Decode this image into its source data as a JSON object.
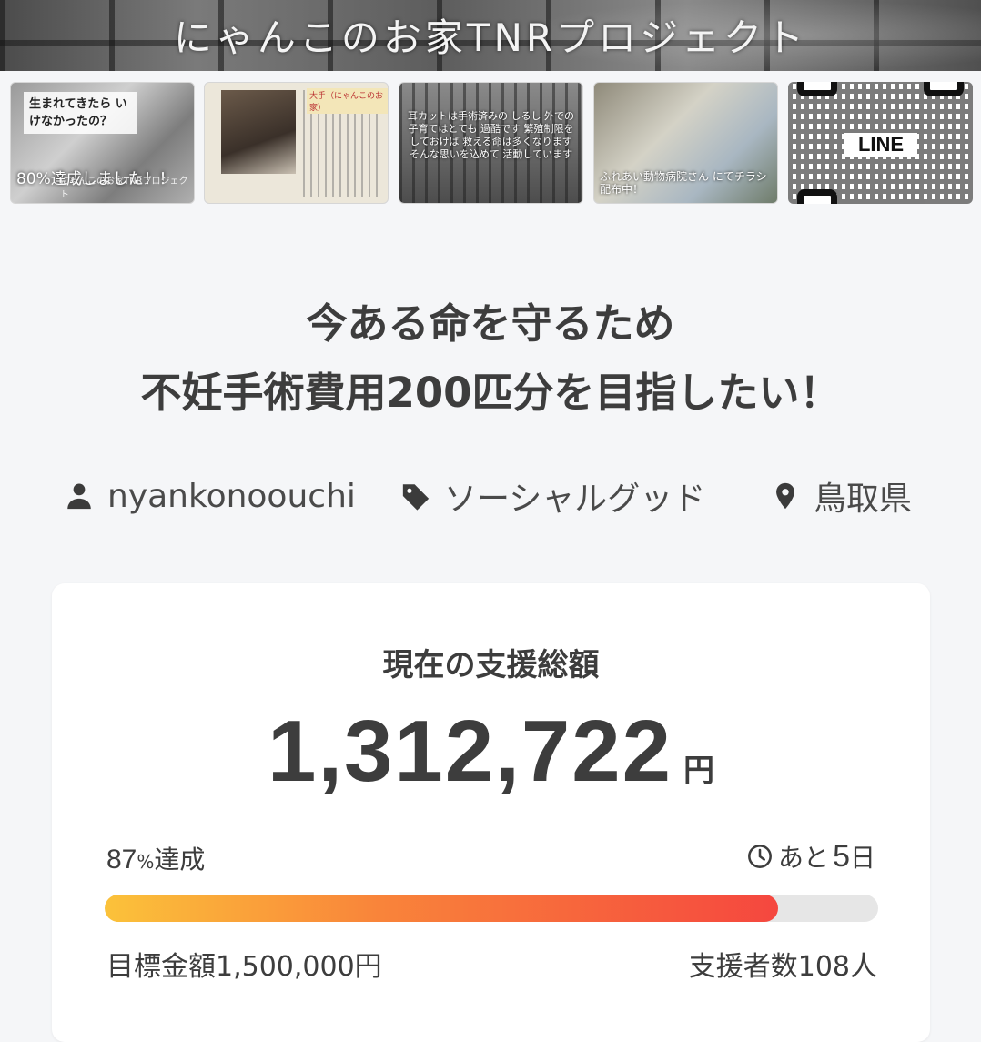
{
  "hero": {
    "title": "にゃんこのお家TNRプロジェクト"
  },
  "thumbnails": [
    {
      "caption_note": "生まれてきたら いけなかったの？",
      "caption_big": "80%達成しました！！",
      "caption_small": "にゃんこのお家TNRプロジェクト"
    },
    {
      "tag": "大手（にゃんこのお家）"
    },
    {
      "caption": "耳カットは手術済みの しるし 外での子育てはとても 過酷です 繁殖制限をしておけば 救える命は多くなります そんな思いを込めて 活動しています"
    },
    {
      "caption": "ふれあい動物病院さん にてチラシ配布中！"
    },
    {
      "label": "LINE"
    }
  ],
  "title": {
    "line1": "今ある命を守るため",
    "line2": "不妊手術費用200匹分を目指したい！"
  },
  "meta": {
    "user": "nyankonoouchi",
    "category": "ソーシャルグッド",
    "location": "鳥取県"
  },
  "funding": {
    "label": "現在の支援総額",
    "amount": "1,312,722",
    "currency": "円",
    "percent": "87",
    "percent_symbol": "%",
    "percent_suffix": "達成",
    "progress": 0.87,
    "remaining_prefix": "あと",
    "remaining_days": "5",
    "remaining_unit": "日",
    "goal": "目標金額1,500,000円",
    "supporters": "支援者数108人"
  },
  "colors": {
    "progress_start": "#fbc23a",
    "progress_end": "#f5473f",
    "track": "#e6e6e6"
  }
}
